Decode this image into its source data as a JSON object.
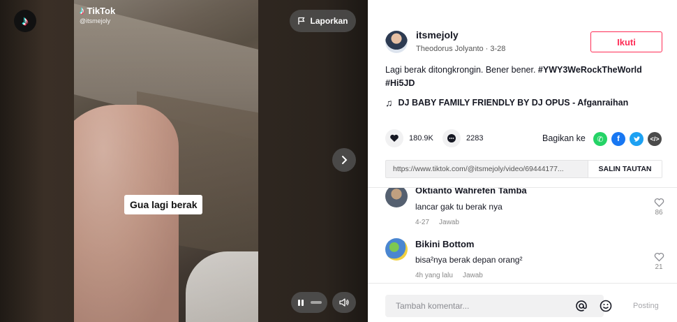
{
  "video": {
    "watermark_brand": "TikTok",
    "watermark_handle": "@itsmejoly",
    "report_label": "Laporkan",
    "caption": "Gua lagi berak"
  },
  "author": {
    "username": "itsmejoly",
    "subline": "Theodorus Jolyanto · 3-28",
    "follow_label": "Ikuti"
  },
  "description": {
    "text": "Lagi berak ditongkrongin. Bener bener.",
    "hashtags": [
      "#YWY3WeRockTheWorld",
      "#Hi5JD"
    ]
  },
  "music": "DJ BABY FAMILY FRIENDLY BY DJ OPUS - Afganraihan",
  "stats": {
    "likes": "180.9K",
    "comments": "2283"
  },
  "share": {
    "label": "Bagikan ke"
  },
  "link": {
    "url": "https://www.tiktok.com/@itsmejoly/video/69444177...",
    "copy_label": "SALIN TAUTAN"
  },
  "comments": [
    {
      "name": "Oktianto Wahrefen Tamba",
      "text": "lancar gak tu berak nya",
      "time": "4-27",
      "reply": "Jawab",
      "likes": "86"
    },
    {
      "name": "Bikini Bottom",
      "text": "bisa²nya berak depan orang²",
      "time": "4h yang lalu",
      "reply": "Jawab",
      "likes": "21"
    }
  ],
  "composer": {
    "placeholder": "Tambah komentar...",
    "post_label": "Posting"
  },
  "colors": {
    "accent": "#fe2c55",
    "whatsapp": "#25d366",
    "facebook": "#1877f2",
    "twitter": "#1da1f2",
    "embed": "#4b4b4b"
  }
}
